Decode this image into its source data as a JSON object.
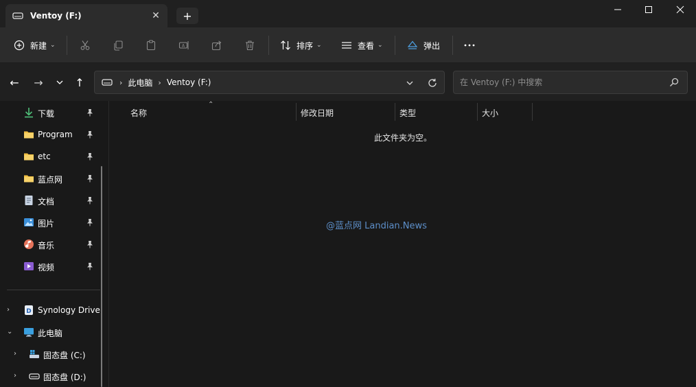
{
  "tab": {
    "title": "Ventoy (F:)",
    "close": "✕",
    "new_tab": "+"
  },
  "window_controls": {
    "minimize": "—",
    "maximize": "☐",
    "close": "✕"
  },
  "toolbar": {
    "new_label": "新建",
    "sort_label": "排序",
    "view_label": "查看",
    "eject_label": "弹出",
    "more": "···",
    "icons": [
      "cut-icon",
      "copy-icon",
      "paste-icon",
      "rename-icon",
      "share-icon",
      "delete-icon"
    ]
  },
  "nav": {
    "back": "←",
    "forward": "→",
    "recent": "⌄",
    "up": "↑"
  },
  "address": {
    "crumbs": [
      "此电脑",
      "Ventoy (F:)"
    ],
    "separator": "›",
    "search_placeholder": "在 Ventoy (F:) 中搜索"
  },
  "sidebar": {
    "quick_access": [
      {
        "label": "下载",
        "icon": "download-icon",
        "pinned": true
      },
      {
        "label": "Program",
        "icon": "folder-icon",
        "pinned": true
      },
      {
        "label": "etc",
        "icon": "folder-icon",
        "pinned": true
      },
      {
        "label": "蓝点网",
        "icon": "folder-icon",
        "pinned": true
      },
      {
        "label": "文档",
        "icon": "document-icon",
        "pinned": true
      },
      {
        "label": "图片",
        "icon": "pictures-icon",
        "pinned": true
      },
      {
        "label": "音乐",
        "icon": "music-icon",
        "pinned": true
      },
      {
        "label": "视频",
        "icon": "video-icon",
        "pinned": true
      }
    ],
    "tree": [
      {
        "label": "Synology Drive",
        "icon": "synology-drive-icon",
        "expander": "›"
      },
      {
        "label": "此电脑",
        "icon": "this-pc-icon",
        "expander": "⌄"
      },
      {
        "label": "固态盘 (C:)",
        "icon": "system-drive-icon",
        "expander": "›"
      },
      {
        "label": "固态盘 (D:)",
        "icon": "drive-icon",
        "expander": "›"
      }
    ]
  },
  "columns": {
    "name": "名称",
    "modified": "修改日期",
    "type": "类型",
    "size": "大小",
    "sort_caret": "⌃"
  },
  "empty_message": "此文件夹为空。",
  "watermark": "@蓝点网 Landian.News",
  "colors": {
    "background": "#191919",
    "toolbar": "#2c2c2c",
    "titlebar": "#202020",
    "accent_blue": "#5d8fc9",
    "folder_yellow": "#f2c043"
  }
}
